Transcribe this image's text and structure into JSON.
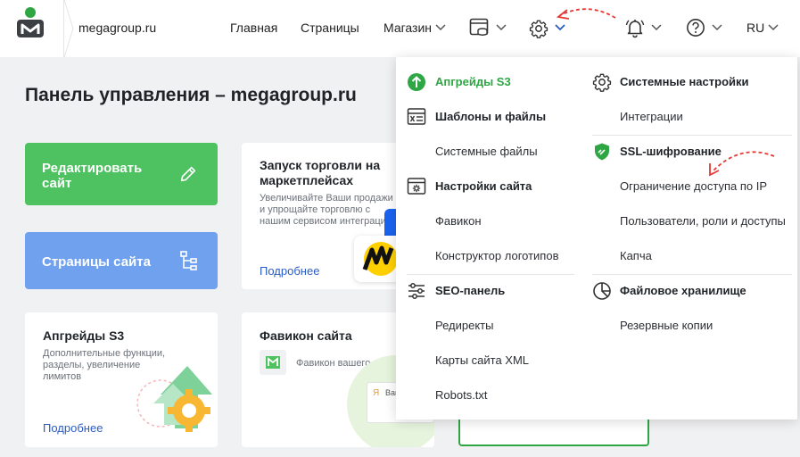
{
  "header": {
    "domain": "megagroup.ru",
    "nav": [
      {
        "label": "Главная"
      },
      {
        "label": "Страницы"
      },
      {
        "label": "Магазин"
      }
    ],
    "language": "RU"
  },
  "main": {
    "title": "Панель управления – megagroup.ru",
    "tiles": {
      "edit_site": "Редактировать сайт",
      "site_pages": "Страницы сайта"
    },
    "cards": {
      "marketplaces": {
        "title": "Запуск торговли на маркетплейсах",
        "description": "Увеличивайте Ваши продажи и упрощайте торговлю с нашим сервисом интеграции.",
        "link": "Подробнее"
      },
      "upgrades": {
        "title": "Апгрейды S3",
        "description": "Дополнительные функции, разделы, увеличение лимитов",
        "link": "Подробнее"
      },
      "favicon": {
        "title": "Фавикон сайта",
        "description": "Фавикон вашего сайта",
        "preview_fragment": "Ваш"
      }
    }
  },
  "dropdown": {
    "left": [
      {
        "label": "Апгрейды S3",
        "style": "green",
        "icon": "arrow-up-circle-icon"
      },
      {
        "label": "Шаблоны и файлы",
        "style": "bold",
        "icon": "template-icon"
      },
      {
        "label": "Системные файлы",
        "style": "normal"
      },
      {
        "label": "Настройки сайта",
        "style": "bold",
        "icon": "site-settings-icon"
      },
      {
        "label": "Фавикон",
        "style": "normal"
      },
      {
        "label": "Конструктор логотипов",
        "style": "normal"
      },
      {
        "label": "SEO-панель",
        "style": "bold",
        "icon": "sliders-icon"
      },
      {
        "label": "Редиректы",
        "style": "normal"
      },
      {
        "label": "Карты сайта XML",
        "style": "normal"
      },
      {
        "label": "Robots.txt",
        "style": "normal"
      }
    ],
    "right": [
      {
        "label": "Системные настройки",
        "style": "bold",
        "icon": "gear-icon"
      },
      {
        "label": "Интеграции",
        "style": "normal"
      },
      {
        "label": "SSL-шифрование",
        "style": "bold",
        "icon": "shield-icon"
      },
      {
        "label": "Ограничение доступа по IP",
        "style": "normal"
      },
      {
        "label": "Пользователи, роли и доступы",
        "style": "normal"
      },
      {
        "label": "Капча",
        "style": "normal"
      },
      {
        "label": "Файловое хранилище",
        "style": "bold",
        "icon": "pie-chart-icon"
      },
      {
        "label": "Резервные копии",
        "style": "normal"
      }
    ]
  },
  "colors": {
    "accent_green": "#4ec260",
    "accent_blue": "#6fa1ee",
    "link_blue": "#2a5cc4",
    "annotation_red": "#e53935"
  }
}
